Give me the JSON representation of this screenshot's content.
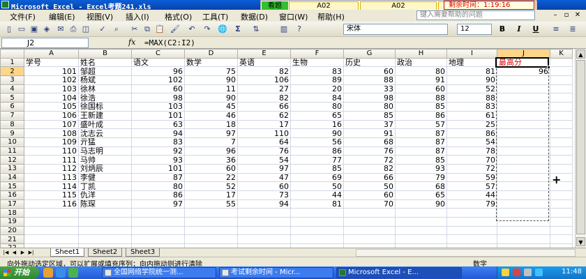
{
  "window": {
    "title": "Microsoft Excel - Excel考题241.xls"
  },
  "exam_bar": {
    "look_label": "看题",
    "cell1": "A02",
    "cell2": "A02",
    "timer": "剩余时间：1:19:16"
  },
  "menu": {
    "items": [
      "文件(F)",
      "编辑(E)",
      "视图(V)",
      "插入(I)",
      "格式(O)",
      "工具(T)",
      "数据(D)",
      "窗口(W)",
      "帮助(H)"
    ],
    "help_placeholder": "键入需要帮助的问题"
  },
  "toolbar": {
    "font_name": "宋体",
    "font_size": "12",
    "bold": "B",
    "italic": "I",
    "underline": "U",
    "sum": "Σ"
  },
  "formula_bar": {
    "name_box": "J2",
    "fx": "fx",
    "formula": "=MAX(C2:I2)"
  },
  "sheet": {
    "columns": [
      "A",
      "B",
      "C",
      "D",
      "E",
      "F",
      "G",
      "H",
      "I",
      "J",
      "K"
    ],
    "rows": [
      [
        "学号",
        "姓名",
        "语文",
        "数学",
        "英语",
        "生物",
        "历史",
        "政治",
        "地理",
        "最高分",
        ""
      ],
      [
        "101",
        "邹超",
        "96",
        "75",
        "82",
        "83",
        "60",
        "80",
        "81",
        "96",
        ""
      ],
      [
        "102",
        "杨斌",
        "102",
        "90",
        "106",
        "89",
        "88",
        "91",
        "90",
        "",
        ""
      ],
      [
        "103",
        "徐林",
        "60",
        "11",
        "27",
        "20",
        "33",
        "60",
        "52",
        "",
        ""
      ],
      [
        "104",
        "徐浩",
        "98",
        "90",
        "82",
        "84",
        "98",
        "88",
        "88",
        "",
        ""
      ],
      [
        "105",
        "徐国标",
        "103",
        "45",
        "66",
        "80",
        "80",
        "85",
        "83",
        "",
        ""
      ],
      [
        "106",
        "王新建",
        "101",
        "46",
        "62",
        "65",
        "85",
        "86",
        "61",
        "",
        ""
      ],
      [
        "107",
        "盛叶成",
        "63",
        "18",
        "17",
        "16",
        "37",
        "57",
        "25",
        "",
        ""
      ],
      [
        "108",
        "沈志云",
        "94",
        "97",
        "110",
        "90",
        "91",
        "87",
        "86",
        "",
        ""
      ],
      [
        "109",
        "亓猛",
        "83",
        "7",
        "64",
        "56",
        "68",
        "87",
        "54",
        "",
        ""
      ],
      [
        "110",
        "马志明",
        "92",
        "96",
        "76",
        "86",
        "76",
        "87",
        "78",
        "",
        ""
      ],
      [
        "111",
        "马帅",
        "93",
        "36",
        "54",
        "77",
        "72",
        "85",
        "70",
        "",
        ""
      ],
      [
        "112",
        "刘炳辰",
        "101",
        "60",
        "97",
        "85",
        "82",
        "93",
        "72",
        "",
        ""
      ],
      [
        "113",
        "李健",
        "87",
        "22",
        "47",
        "69",
        "66",
        "79",
        "59",
        "",
        ""
      ],
      [
        "114",
        "丁凯",
        "80",
        "52",
        "60",
        "50",
        "50",
        "68",
        "57",
        "",
        ""
      ],
      [
        "115",
        "仇洋",
        "86",
        "17",
        "73",
        "44",
        "60",
        "65",
        "44",
        "",
        ""
      ],
      [
        "116",
        "陈琛",
        "97",
        "55",
        "94",
        "81",
        "70",
        "90",
        "79",
        "",
        ""
      ],
      [
        "",
        "",
        "",
        "",
        "",
        "",
        "",
        "",
        "",
        "",
        ""
      ],
      [
        "",
        "",
        "",
        "",
        "",
        "",
        "",
        "",
        "",
        "",
        ""
      ],
      [
        "",
        "",
        "",
        "",
        "",
        "",
        "",
        "",
        "",
        "",
        ""
      ],
      [
        "",
        "",
        "",
        "",
        "",
        "",
        "",
        "",
        "",
        "",
        ""
      ],
      [
        "",
        "",
        "",
        "",
        "",
        "",
        "",
        "",
        "",
        "",
        ""
      ],
      [
        "",
        "",
        "",
        "",
        "",
        "",
        "",
        "",
        "",
        "",
        ""
      ]
    ]
  },
  "tabs": [
    "Sheet1",
    "Sheet2",
    "Sheet3"
  ],
  "status": {
    "message": "向外拖动选定区域，可以扩展或填充序列；向内拖动则进行清除",
    "mode": "数字"
  },
  "taskbar": {
    "start": "开始",
    "buttons": [
      "全国网络学院统一测...",
      "考试剩余时间 - Micr...",
      "Microsoft Excel - E..."
    ],
    "clock": "11:48"
  }
}
